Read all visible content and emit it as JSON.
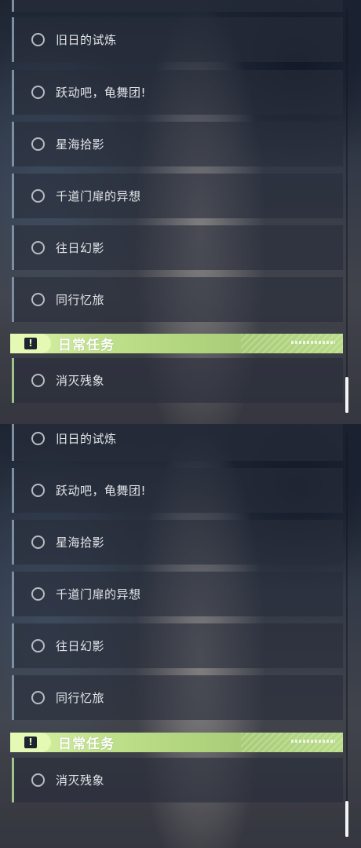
{
  "missions": [
    {
      "label": "旧日的试炼"
    },
    {
      "label": "跃动吧，龟舞团!"
    },
    {
      "label": "星海拾影"
    },
    {
      "label": "千道门扉的异想"
    },
    {
      "label": "往日幻影"
    },
    {
      "label": "同行忆旅"
    }
  ],
  "daily_section": {
    "icon": "!",
    "title": "日常任务",
    "missions": [
      {
        "label": "消灭残象"
      }
    ]
  },
  "colors": {
    "accent_green": "#bfe08b",
    "mission_bar": "#7b8fa0",
    "daily_bar": "#9fc489"
  },
  "icons": [
    "circle-status-icon",
    "exclamation-icon"
  ]
}
